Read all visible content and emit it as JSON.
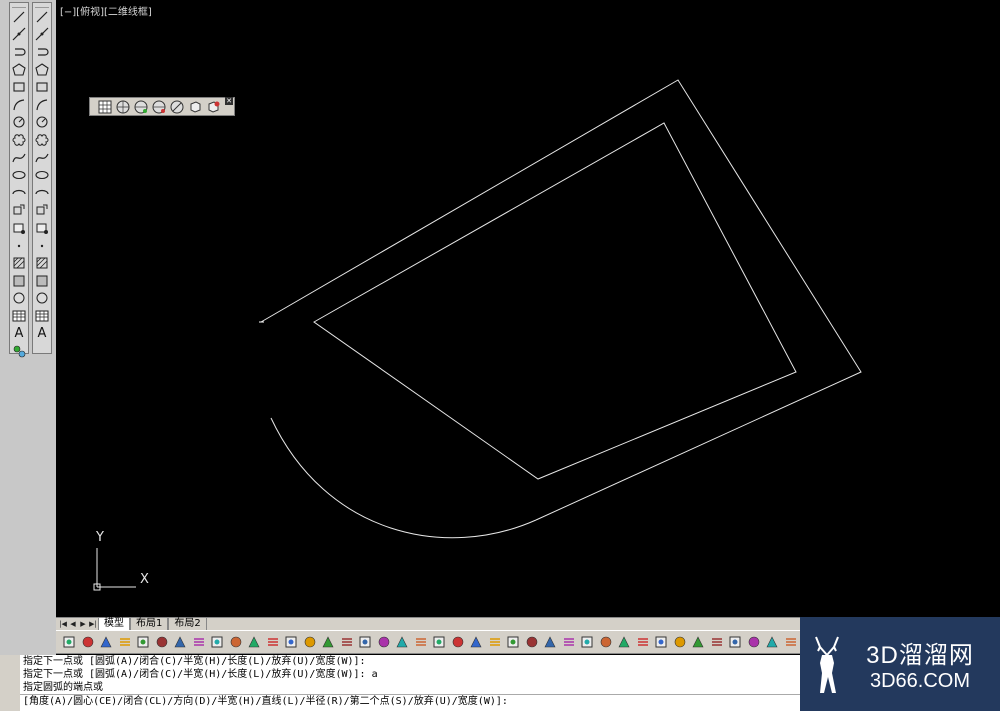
{
  "viewport": {
    "label": "[−][俯视][二维线框]"
  },
  "ucs": {
    "y_label": "Y",
    "x_label": "X"
  },
  "layout_tabs": [
    "模型",
    "布局1",
    "布局2"
  ],
  "command_history": [
    "指定下一点或 [圆弧(A)/闭合(C)/半宽(H)/长度(L)/放弃(U)/宽度(W)]:",
    "指定下一点或 [圆弧(A)/闭合(C)/半宽(H)/长度(L)/放弃(U)/宽度(W)]: a",
    "指定圆弧的端点或"
  ],
  "command_prompt": "[角度(A)/圆心(CE)/闭合(CL)/方向(D)/半宽(H)/直线(L)/半径(R)/第二个点(S)/放弃(U)/宽度(W)]:",
  "watermark": {
    "line1": "3D溜溜网",
    "line2": "3D66.COM"
  },
  "draw_toolbar_icons": [
    "line-icon",
    "construction-line-icon",
    "polyline-icon",
    "polygon-icon",
    "rectangle-icon",
    "arc-icon",
    "circle-icon",
    "revision-cloud-icon",
    "spline-icon",
    "ellipse-icon",
    "ellipse-arc-icon",
    "insert-block-icon",
    "make-block-icon",
    "point-icon",
    "hatch-icon",
    "gradient-icon",
    "region-icon",
    "table-icon",
    "multiline-text-icon",
    "add-selected-icon"
  ],
  "text_icon_glyph": "A"
}
